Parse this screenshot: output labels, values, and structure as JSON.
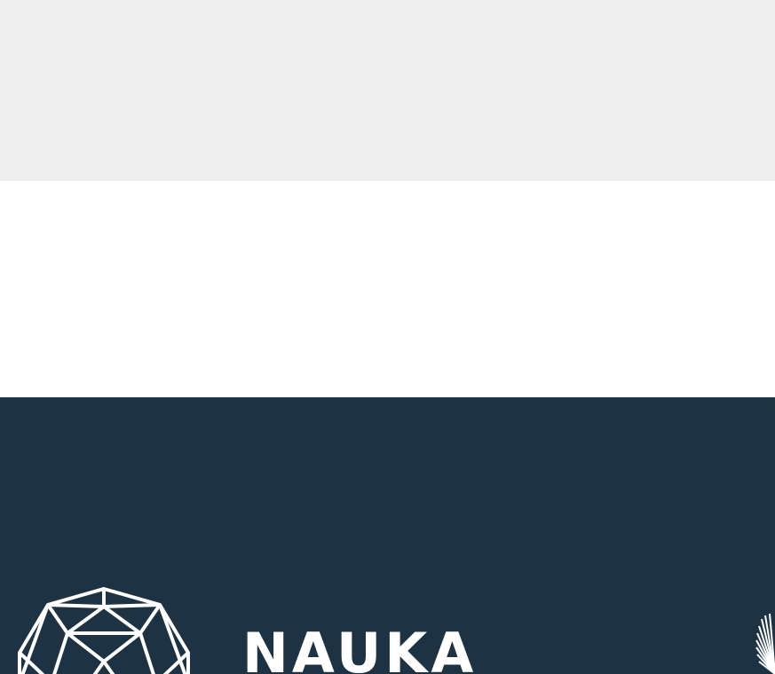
{
  "colors": {
    "top_band": "#efefef",
    "middle_band": "#ffffff",
    "footer_bg": "#1d3344",
    "footer_fg": "#ffffff"
  },
  "footer": {
    "brand_name": "NAUKA",
    "logo_icon": "geodesic-dome-icon",
    "partner_icon": "sunburst-emblem-icon"
  }
}
